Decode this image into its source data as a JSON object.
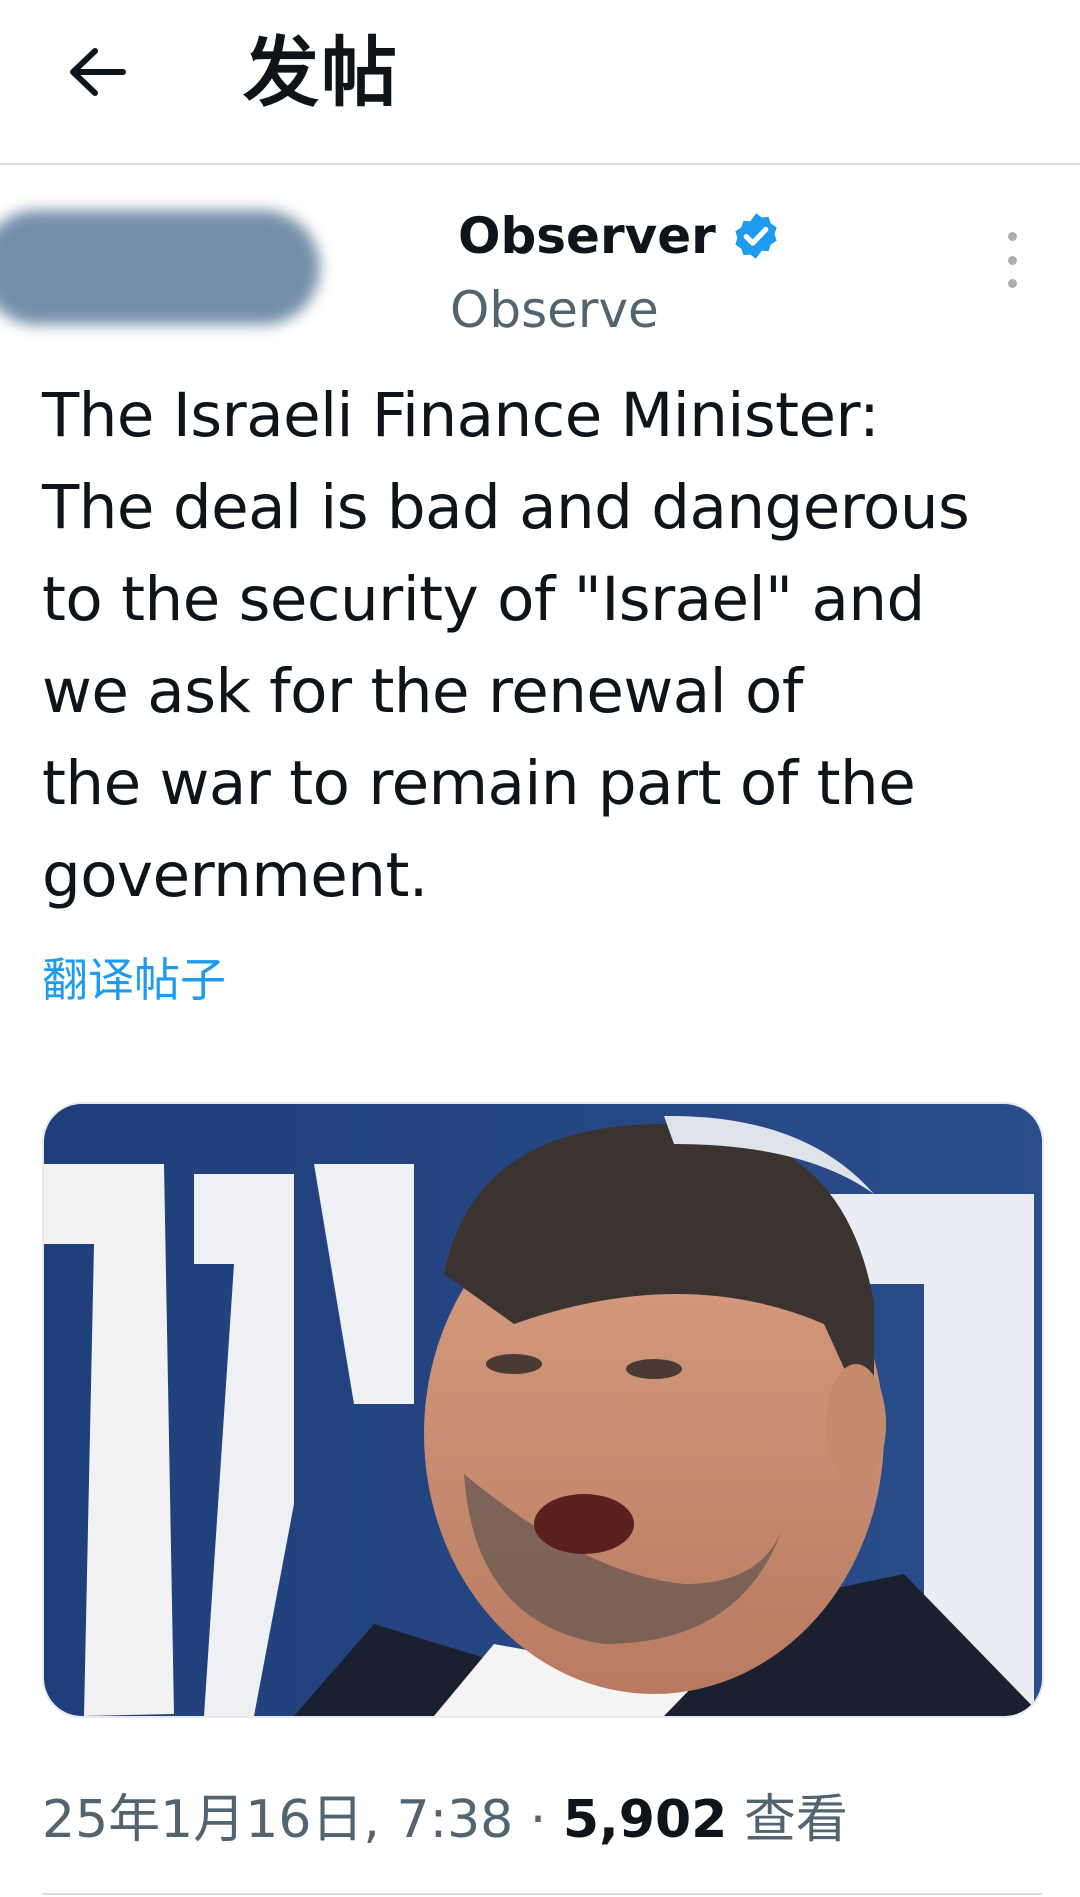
{
  "header": {
    "title": "发帖",
    "back_icon": "arrow-left-icon"
  },
  "author": {
    "display_name": "Observer",
    "handle": "Observe",
    "verified_icon": "verified-badge-icon",
    "verified_color": "#1d9bf0",
    "more_icon": "more-vertical-icon"
  },
  "tweet": {
    "text": "The Israeli Finance Minister:\nThe deal is bad and dangerous\nto the security of \"Israel\" and\nwe ask for the renewal of\nthe war to remain part of the\ngovernment.",
    "translate_label": "翻译帖子",
    "date_time": "25年1月16日, 7:38",
    "separator": " · ",
    "views_count": "5,902",
    "views_label": " 查看"
  },
  "colors": {
    "link": "#1d9bf0",
    "secondary_text": "#536471",
    "primary_text": "#0f1419"
  }
}
